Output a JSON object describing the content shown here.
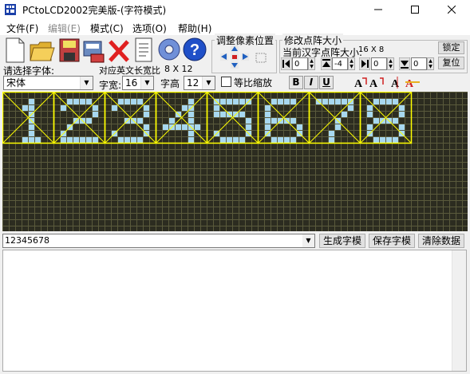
{
  "window": {
    "title": "PCtoLCD2002完美版-(字符模式)"
  },
  "menu": {
    "items": [
      {
        "label": "文件(F)",
        "disabled": false
      },
      {
        "label": "编辑(E)",
        "disabled": true
      },
      {
        "label": "模式(C)",
        "disabled": false
      },
      {
        "label": "选项(O)",
        "disabled": false
      },
      {
        "label": "帮助(H)",
        "disabled": false
      }
    ]
  },
  "toolbar": {
    "icons": [
      "new-icon",
      "open-icon",
      "save-icon",
      "export-icon",
      "delete-icon",
      "document-icon",
      "settings-gear-icon",
      "help-icon"
    ]
  },
  "adjust_group": {
    "label": "调整像素位置"
  },
  "resize_group": {
    "label": "修改点阵大小",
    "current_label": "当前汉字点阵大小:",
    "current_size": "16 X 8",
    "spin_values": [
      "0",
      "-4",
      "0",
      "0"
    ],
    "lock_label": "锁定",
    "reset_label": "复位"
  },
  "font": {
    "select_label": "请选择字体:",
    "font_value": "宋体",
    "ascii_label": "对应英文长宽比",
    "ascii_ratio": "8 X 12",
    "width_label": "字宽:",
    "width_value": "16",
    "height_label": "字高",
    "height_value": "12",
    "proportional_label": "等比缩放",
    "bold": "B",
    "italic": "I",
    "underline": "U"
  },
  "glyphs": [
    "1",
    "2",
    "3",
    "4",
    "5",
    "6",
    "7",
    "8"
  ],
  "colors": {
    "canvas_bg": "#2c2c20",
    "pixel_on": "#a8d8f0",
    "grid": "#5a5a3c",
    "cell_border": "#ffff00"
  },
  "input": {
    "text": "12345678"
  },
  "actions": {
    "generate": "生成字模",
    "save": "保存字模",
    "clear": "清除数据"
  }
}
